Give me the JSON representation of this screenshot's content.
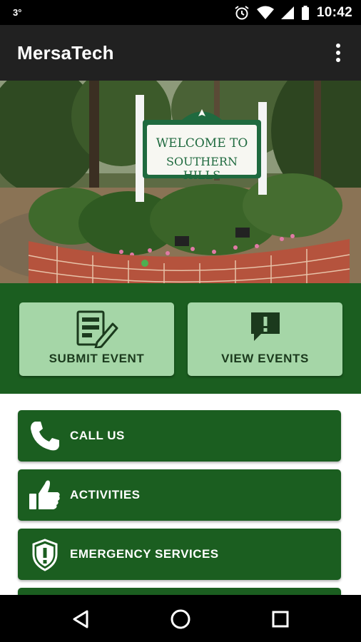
{
  "status_bar": {
    "left_text": "3°",
    "time": "10:42",
    "icons": [
      "alarm-icon",
      "wifi-icon",
      "signal-icon",
      "battery-icon"
    ]
  },
  "app_bar": {
    "title": "MersaTech",
    "menu_icon": "overflow-menu-icon"
  },
  "hero": {
    "sign_line1": "WELCOME TO",
    "sign_line2": "SOUTHERN HILLS"
  },
  "actions": [
    {
      "label": "SUBMIT EVENT",
      "icon": "form-edit-icon"
    },
    {
      "label": "VIEW EVENTS",
      "icon": "chat-alert-icon"
    }
  ],
  "menu_items": [
    {
      "label": "CALL US",
      "icon": "phone-icon"
    },
    {
      "label": "ACTIVITIES",
      "icon": "thumbs-up-icon"
    },
    {
      "label": "EMERGENCY SERVICES",
      "icon": "shield-icon"
    }
  ],
  "navigation": [
    "back-icon",
    "home-icon",
    "recents-icon"
  ],
  "colors": {
    "primary_dark_green": "#1b5e20",
    "light_green": "#a5d6a7",
    "app_bar": "#212121",
    "status_bar": "#000000"
  }
}
